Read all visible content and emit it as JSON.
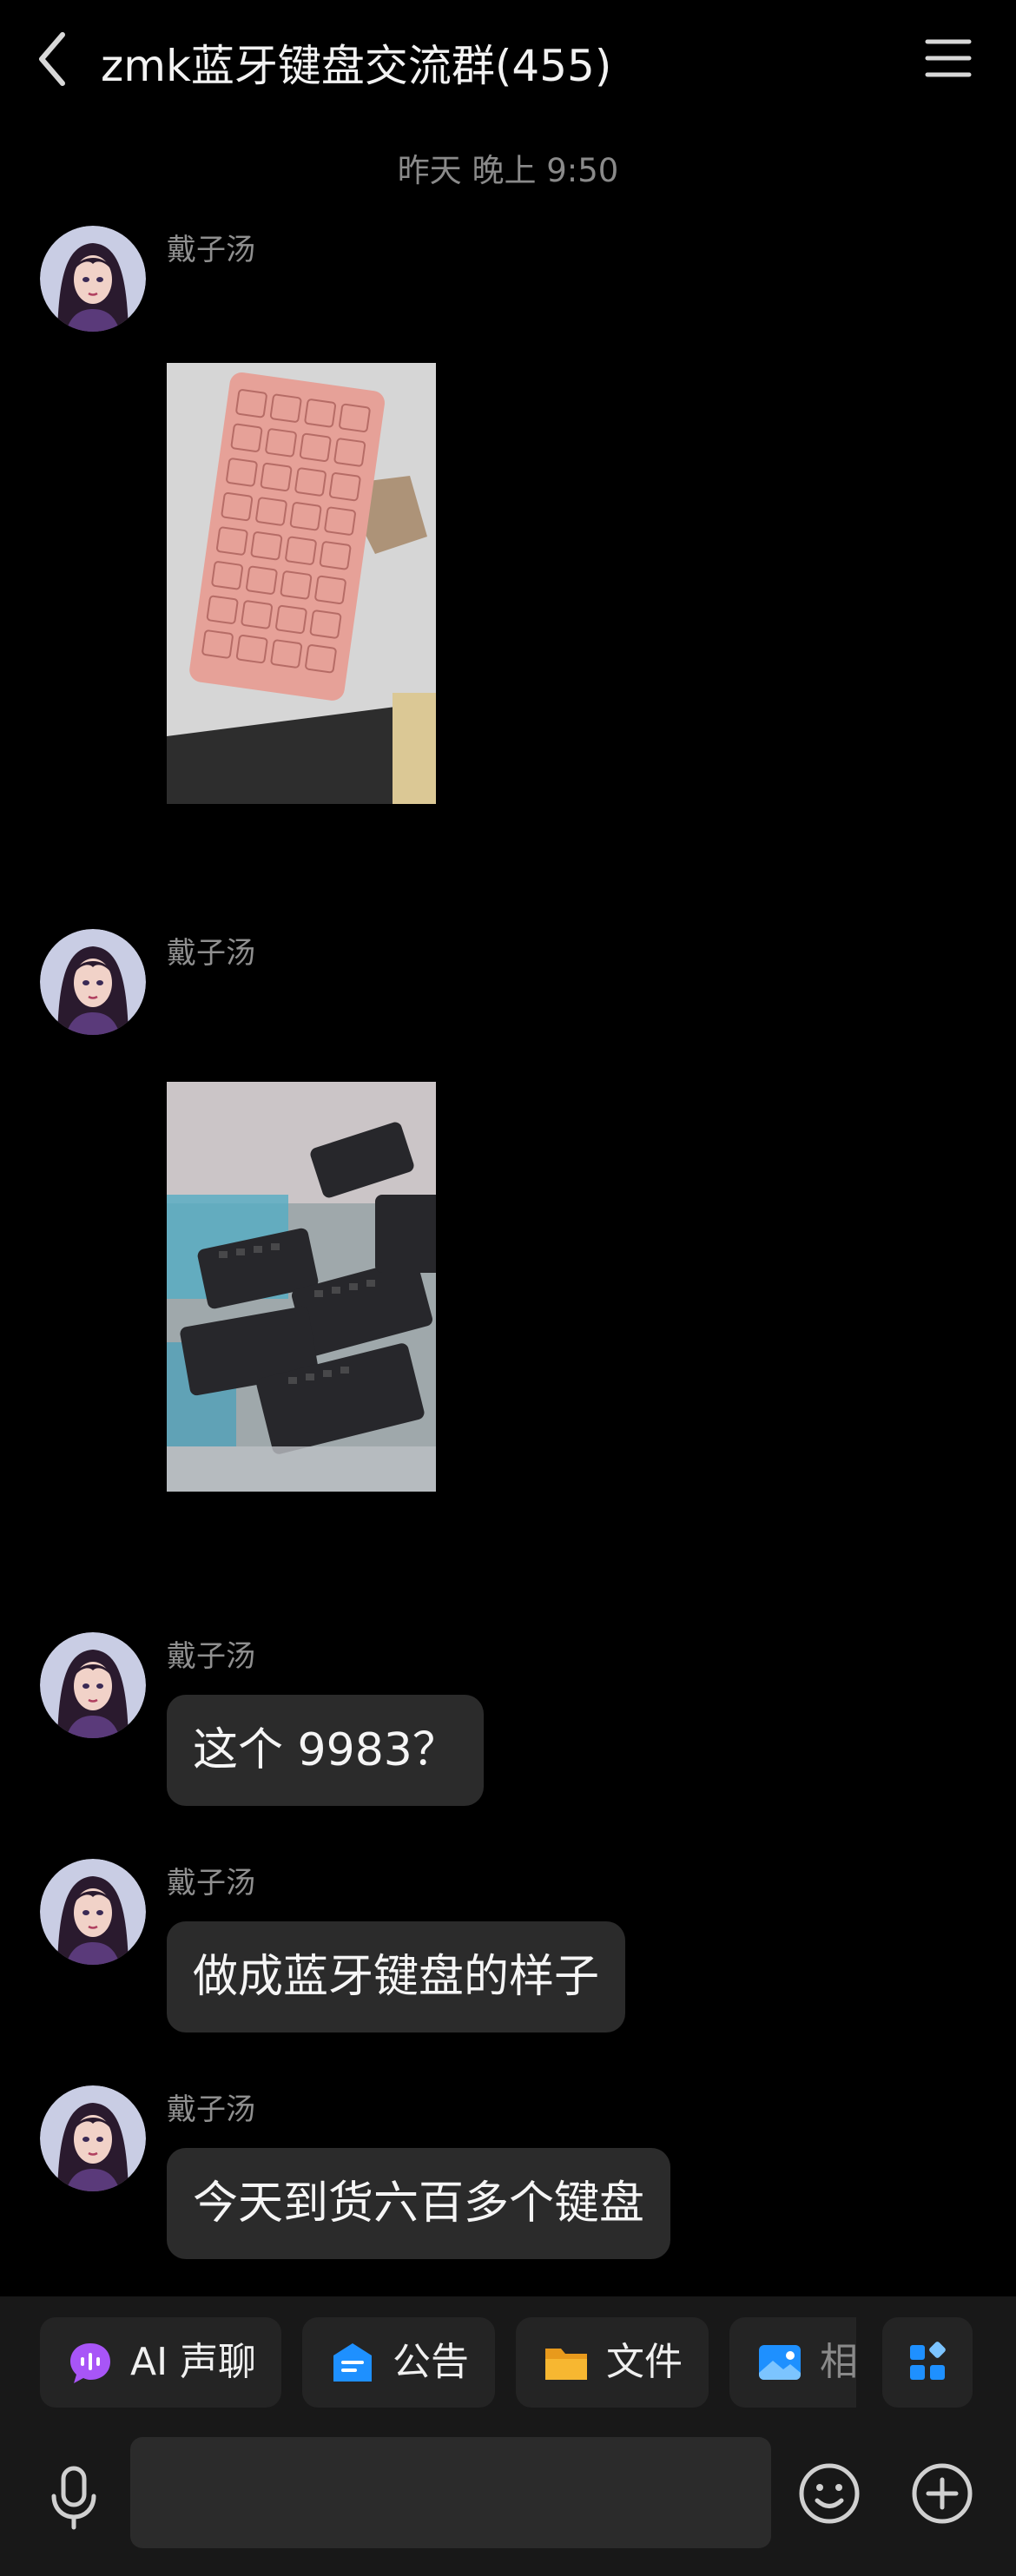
{
  "header": {
    "title": "zmk蓝牙键盘交流群(455)"
  },
  "timestamp": "昨天 晚上 9:50",
  "messages": [
    {
      "sender": "戴子汤",
      "type": "image",
      "image_desc": "pink keyboard"
    },
    {
      "sender": "戴子汤",
      "type": "image",
      "image_desc": "black keyboards"
    },
    {
      "sender": "戴子汤",
      "type": "text",
      "text": "这个 9983？"
    },
    {
      "sender": "戴子汤",
      "type": "text",
      "text": "做成蓝牙键盘的样子"
    },
    {
      "sender": "戴子汤",
      "type": "text",
      "text": "今天到货六百多个键盘"
    }
  ],
  "toolbar": {
    "items": [
      {
        "label": "AI 声聊",
        "icon": "ai-voice-chat-icon"
      },
      {
        "label": "公告",
        "icon": "announcement-icon"
      },
      {
        "label": "文件",
        "icon": "folder-icon"
      },
      {
        "label": "相",
        "icon": "album-icon"
      },
      {
        "label": "",
        "icon": "apps-grid-icon"
      }
    ]
  },
  "input": {
    "placeholder": ""
  },
  "colors": {
    "background": "#000000",
    "bubble": "#2b2b2b",
    "bottom_bar": "#181818",
    "tool_chip": "#242424",
    "accent_blue": "#1e90ff",
    "accent_purple": "#a855f7",
    "accent_orange": "#f7b731"
  }
}
